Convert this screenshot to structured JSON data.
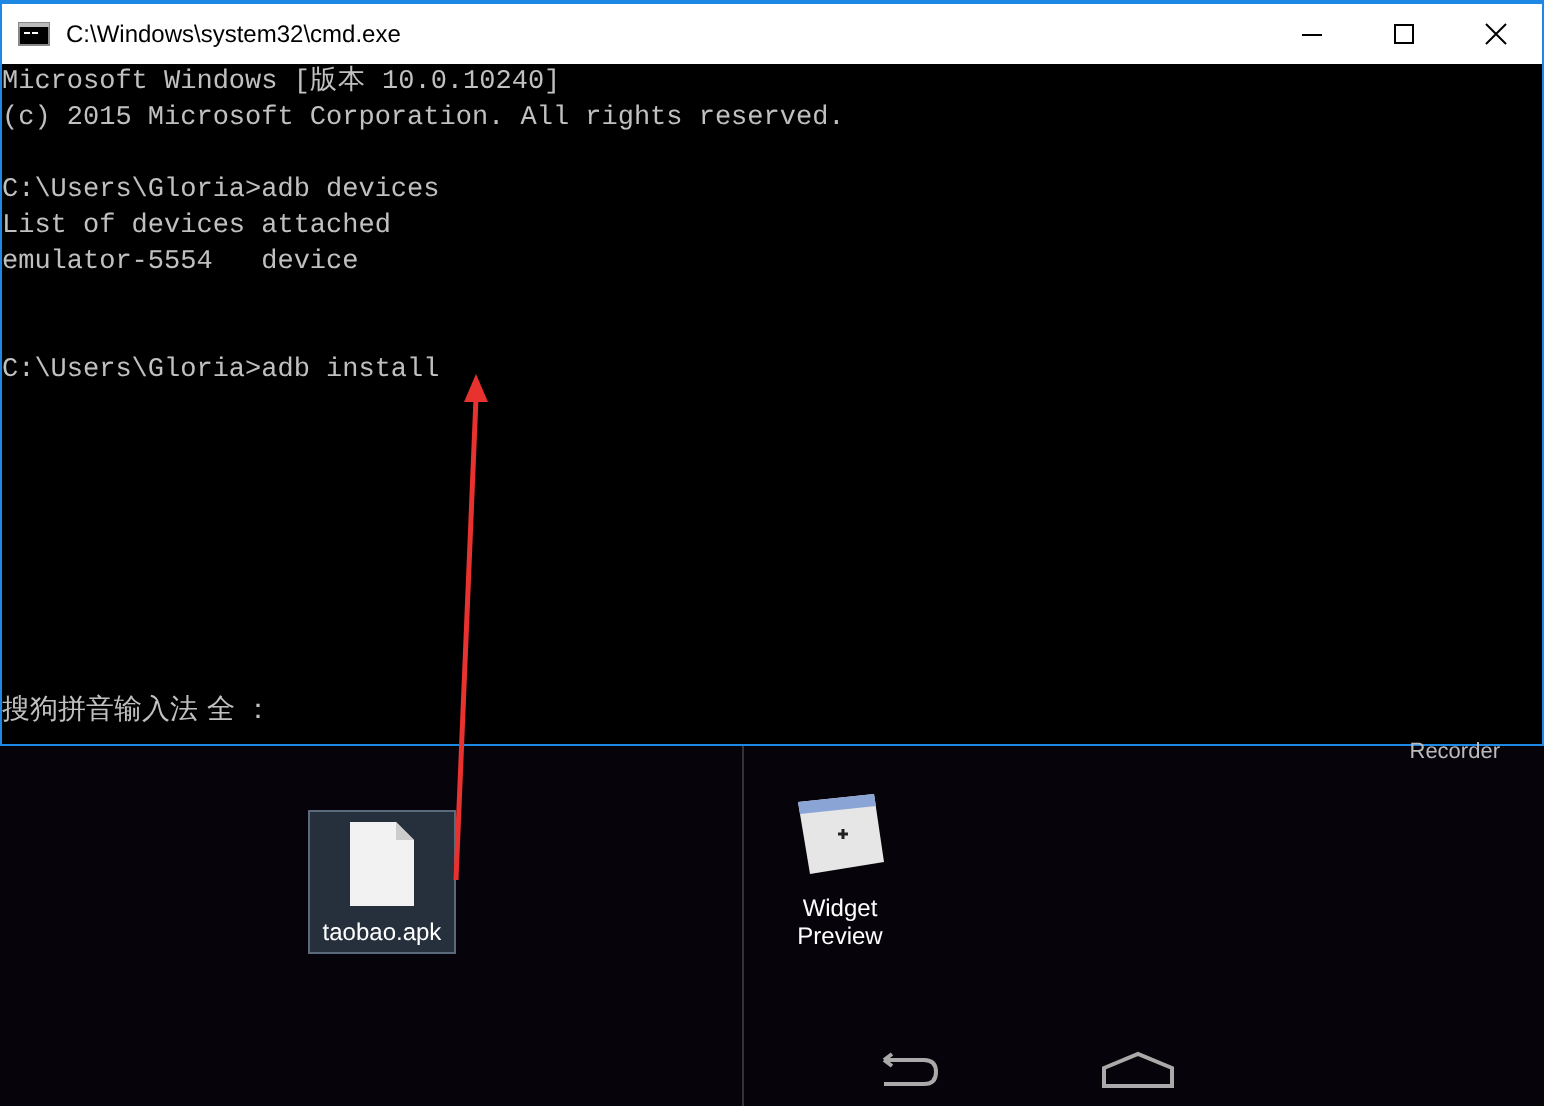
{
  "window": {
    "title": "C:\\Windows\\system32\\cmd.exe"
  },
  "console": {
    "blocks": [
      [
        "Microsoft Windows [版本 10.0.10240]",
        "(c) 2015 Microsoft Corporation. All rights reserved."
      ],
      [
        "C:\\Users\\Gloria>adb devices",
        "List of devices attached",
        "emulator-5554   device"
      ],
      [
        "C:\\Users\\Gloria>adb install"
      ]
    ],
    "ime_status": "搜狗拼音输入法 全 ："
  },
  "emulator": {
    "file": {
      "name": "taobao.apk",
      "selected": true
    },
    "recorder_label": "Recorder",
    "app": {
      "label": "Widget Preview"
    }
  }
}
